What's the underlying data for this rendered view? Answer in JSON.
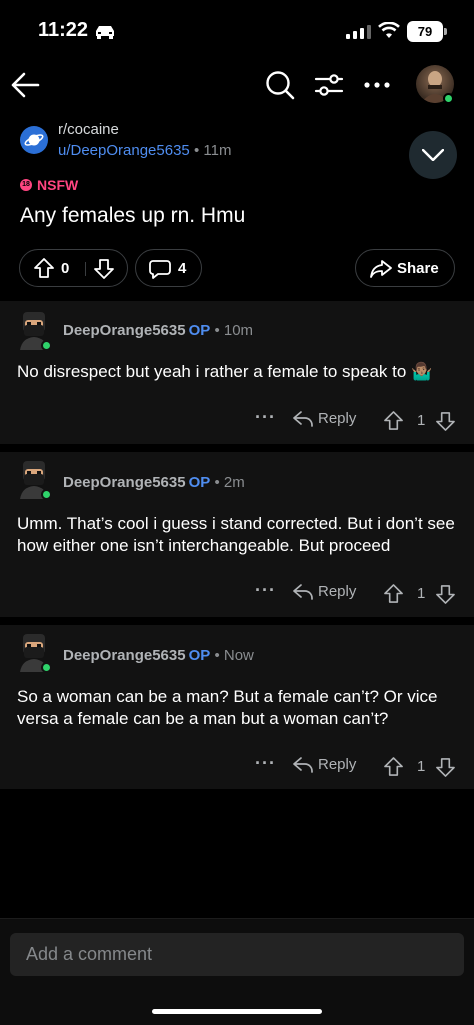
{
  "status": {
    "time": "11:22",
    "battery": "79"
  },
  "post": {
    "subreddit": "r/cocaine",
    "author": "u/DeepOrange5635",
    "separator": "•",
    "age": "11m",
    "nsfw_label": "NSFW",
    "nsfw_badge": "18",
    "title": "Any females up rn. Hmu",
    "votes": "0",
    "comments": "4",
    "share_label": "Share"
  },
  "comments": [
    {
      "author": "DeepOrange5635",
      "op": "OP",
      "time": "10m",
      "body": "No disrespect but yeah i rather a female to speak to 🤷🏽‍♂️",
      "reply": "Reply",
      "votes": "1"
    },
    {
      "author": "DeepOrange5635",
      "op": "OP",
      "time": "2m",
      "body": "Umm. That’s cool i guess i stand corrected. But i don’t see how either one isn’t interchangeable. But proceed",
      "reply": "Reply",
      "votes": "1"
    },
    {
      "author": "DeepOrange5635",
      "op": "OP",
      "time": "Now",
      "body": "So a woman can be a man? But a female can’t? Or vice versa a female can be a man but a woman can’t?",
      "reply": "Reply",
      "votes": "1"
    }
  ],
  "composer": {
    "placeholder": "Add a comment"
  }
}
